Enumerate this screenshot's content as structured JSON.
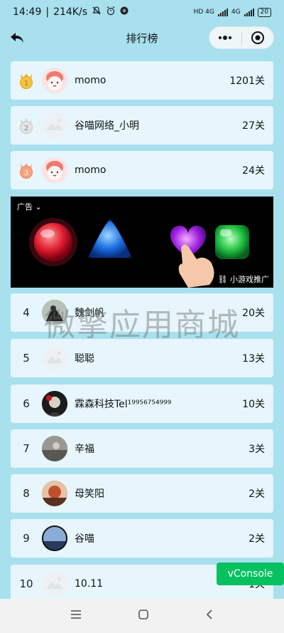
{
  "status_bar": {
    "time": "14:49",
    "speed": "214K/s",
    "net1": "HD 4G",
    "net2": "4G",
    "battery": "20"
  },
  "nav": {
    "title": "排行榜",
    "more_icon": "more-dots-icon",
    "close_icon": "target-circle-icon"
  },
  "ranking": [
    {
      "rank": "1",
      "name": "momo",
      "score": "1201关",
      "avatar": "pink-cat",
      "medal": "gold"
    },
    {
      "rank": "2",
      "name": "谷喵网络_小明",
      "score": "27关",
      "avatar": "default",
      "medal": "silver"
    },
    {
      "rank": "3",
      "name": "momo",
      "score": "24关",
      "avatar": "pink-cat",
      "medal": "bronze"
    },
    {
      "rank": "4",
      "name": "魏剑帆",
      "score": "20关",
      "avatar": "photo-rider"
    },
    {
      "rank": "5",
      "name": "聪聪",
      "score": "13关",
      "avatar": "default"
    },
    {
      "rank": "6",
      "name": "霖森科技Tel¹⁹⁹⁵⁶⁷⁵⁴⁹⁹⁹",
      "score": "10关",
      "avatar": "photo-red"
    },
    {
      "rank": "7",
      "name": "辛福",
      "score": "3关",
      "avatar": "photo-grey"
    },
    {
      "rank": "8",
      "name": "母笑阳",
      "score": "2关",
      "avatar": "photo-sunset"
    },
    {
      "rank": "9",
      "name": "谷喵",
      "score": "2关",
      "avatar": "photo-sky"
    },
    {
      "rank": "10",
      "name": "10.11",
      "score": "1关",
      "avatar": "default"
    }
  ],
  "ad": {
    "label": "广告",
    "footer": "小游戏推广"
  },
  "watermark": "微擎应用商城",
  "vconsole": "vConsole",
  "colors": {
    "background": "#a8e0ee",
    "row": "#e6f6fc",
    "vconsole": "#07c160"
  }
}
